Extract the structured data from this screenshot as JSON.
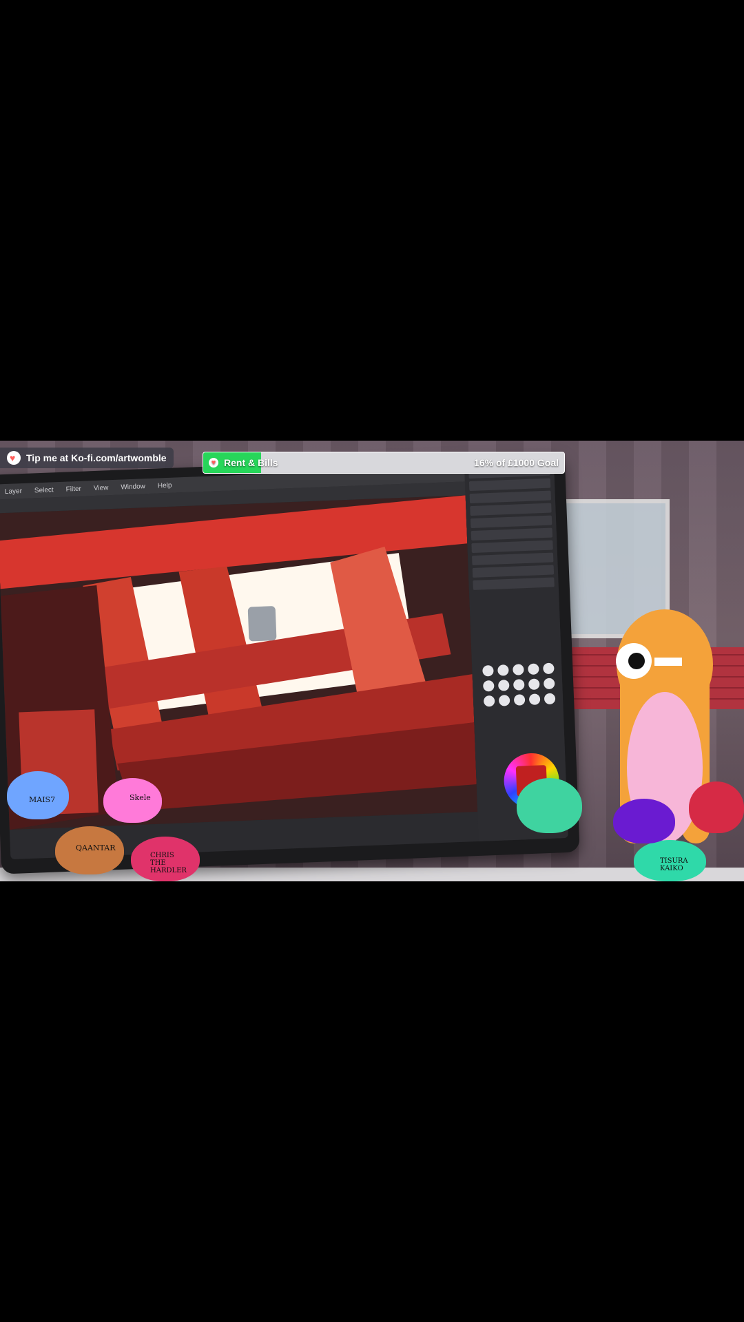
{
  "stream": {
    "kofi_label": "Tip me at Ko-fi.com/artwomble",
    "goal_title": "Rent & Bills",
    "goal_status": "16% of £1000 Goal",
    "goal_progress": 0.16,
    "goal_color": "#27d65a"
  },
  "app": {
    "menu_items": [
      "Layer",
      "Select",
      "Filter",
      "View",
      "Window",
      "Help"
    ]
  },
  "chat_birds": [
    {
      "name": "MAIS7",
      "color": "#6fa5ff"
    },
    {
      "name": "Skele",
      "color": "#ff7ad9"
    },
    {
      "name": "QAANTAR",
      "color": "#c77840"
    },
    {
      "name": "CHRIS THE HARDLER",
      "color": "#e0336a"
    },
    {
      "name": "TISURA KAIKO",
      "color": "#2fd9a9"
    }
  ],
  "icons": {
    "kofi": "heart-cup-icon",
    "goal": "heart-icon"
  }
}
